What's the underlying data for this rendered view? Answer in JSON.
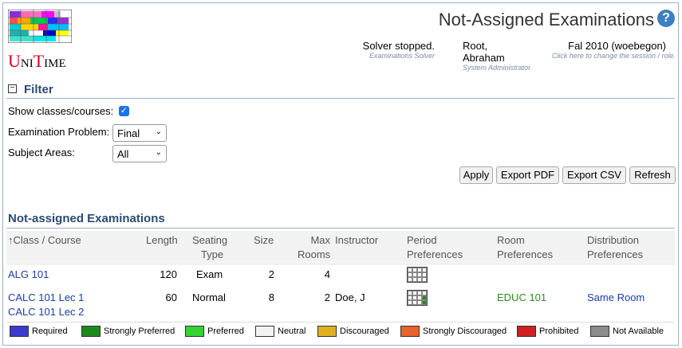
{
  "app": {
    "logo_text": [
      "U",
      "NI",
      "T",
      "IME"
    ]
  },
  "header": {
    "title": "Not-Assigned Examinations",
    "help": "?",
    "solver_status": "Solver stopped.",
    "solver_sub": "Examinations Solver",
    "user": "Root, Abraham",
    "user_sub": "System Administrator",
    "session": "Fal 2010 (woebegon)",
    "session_sub": "Click here to change the session / role."
  },
  "filter": {
    "title": "Filter",
    "show_classes_label": "Show classes/courses:",
    "show_classes_checked": true,
    "problem_label": "Examination Problem:",
    "problem_value": "Final",
    "subject_label": "Subject Areas:",
    "subject_value": "All",
    "buttons": {
      "apply": "Apply",
      "export_pdf": "Export PDF",
      "export_csv": "Export CSV",
      "refresh": "Refresh"
    }
  },
  "table": {
    "title": "Not-assigned Examinations",
    "headers": {
      "class_course": "↑Class / Course",
      "length": "Length",
      "seating1": "Seating",
      "seating2": "Type",
      "size": "Size",
      "max1": "Max",
      "max2": "Rooms",
      "instructor": "Instructor",
      "period1": "Period",
      "period2": "Preferences",
      "room1": "Room",
      "room2": "Preferences",
      "dist1": "Distribution",
      "dist2": "Preferences"
    },
    "rows": [
      {
        "classes": [
          "ALG 101"
        ],
        "length": "120",
        "seating": "Exam",
        "size": "2",
        "max_rooms": "4",
        "instructor": "",
        "room_pref": "",
        "dist_pref": ""
      },
      {
        "classes": [
          "CALC 101 Lec 1",
          "CALC 101 Lec 2"
        ],
        "length": "60",
        "seating": "Normal",
        "size": "8",
        "max_rooms": "2",
        "instructor": "Doe, J",
        "room_pref": "EDUC 101",
        "dist_pref": "Same Room"
      }
    ]
  },
  "legend": [
    {
      "label": "Required",
      "color": "#3b3bd1"
    },
    {
      "label": "Strongly Preferred",
      "color": "#1c8a1c"
    },
    {
      "label": "Preferred",
      "color": "#35d235"
    },
    {
      "label": "Neutral",
      "color": "#f2f2f2"
    },
    {
      "label": "Discouraged",
      "color": "#e0b020"
    },
    {
      "label": "Strongly Discouraged",
      "color": "#e8642a"
    },
    {
      "label": "Prohibited",
      "color": "#d02020"
    },
    {
      "label": "Not Available",
      "color": "#8c8c8c"
    }
  ]
}
